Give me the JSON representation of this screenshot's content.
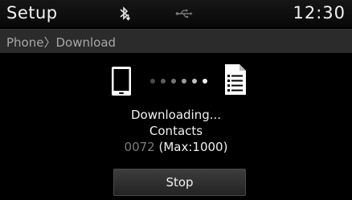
{
  "header": {
    "title": "Setup",
    "clock": "12:30",
    "status_icons": [
      "bluetooth-download-icon",
      "usb-icon"
    ]
  },
  "breadcrumb": {
    "items": [
      "Phone",
      "Download"
    ],
    "separator": "〉"
  },
  "download": {
    "status": "Downloading...",
    "type": "Contacts",
    "count": "0072",
    "max": "(Max:1000)",
    "source_icon": "phone-icon",
    "target_icon": "document-list-icon"
  },
  "actions": {
    "stop_label": "Stop"
  },
  "colors": {
    "background": "#000000",
    "header": "#111111",
    "breadcrumb_bar": "#2b2b2b",
    "muted_count": "#7c7c7c"
  }
}
